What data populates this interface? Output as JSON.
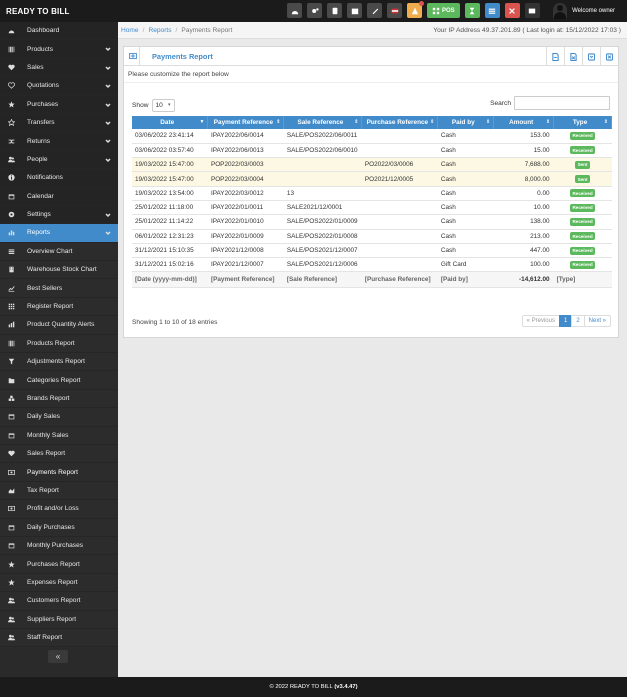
{
  "brand": "READY TO BILL",
  "topbar": {
    "pos_label": "POS",
    "welcome": "Welcome owner"
  },
  "sidebar": {
    "items": [
      {
        "label": "Dashboard",
        "icon": "dashboard-icon"
      },
      {
        "label": "Products",
        "icon": "barcode-icon",
        "chevron": true
      },
      {
        "label": "Sales",
        "icon": "heart-icon",
        "chevron": true
      },
      {
        "label": "Quotations",
        "icon": "heart-outline-icon",
        "chevron": true
      },
      {
        "label": "Purchases",
        "icon": "star-icon",
        "chevron": true
      },
      {
        "label": "Transfers",
        "icon": "star-outline-icon",
        "chevron": true
      },
      {
        "label": "Returns",
        "icon": "random-icon",
        "chevron": true
      },
      {
        "label": "People",
        "icon": "users-icon",
        "chevron": true
      },
      {
        "label": "Notifications",
        "icon": "info-icon"
      },
      {
        "label": "Calendar",
        "icon": "calendar-icon"
      },
      {
        "label": "Settings",
        "icon": "cog-icon",
        "chevron": true
      },
      {
        "label": "Reports",
        "icon": "chart-icon",
        "chevron": true
      }
    ],
    "report_items": [
      {
        "label": "Overview Chart",
        "icon": "bars-icon"
      },
      {
        "label": "Warehouse Stock Chart",
        "icon": "building-icon"
      },
      {
        "label": "Best Sellers",
        "icon": "line-chart-icon"
      },
      {
        "label": "Register Report",
        "icon": "th-icon"
      },
      {
        "label": "Product Quantity Alerts",
        "icon": "bar-chart-icon"
      },
      {
        "label": "Products Report",
        "icon": "barcode-icon"
      },
      {
        "label": "Adjustments Report",
        "icon": "filter-icon"
      },
      {
        "label": "Categories Report",
        "icon": "folder-icon"
      },
      {
        "label": "Brands Report",
        "icon": "cubes-icon"
      },
      {
        "label": "Daily Sales",
        "icon": "calendar-icon"
      },
      {
        "label": "Monthly Sales",
        "icon": "calendar-icon"
      },
      {
        "label": "Sales Report",
        "icon": "heart-icon"
      },
      {
        "label": "Payments Report",
        "icon": "money-icon"
      },
      {
        "label": "Tax Report",
        "icon": "area-chart-icon"
      },
      {
        "label": "Profit and/or Loss",
        "icon": "money-icon"
      },
      {
        "label": "Daily Purchases",
        "icon": "calendar-icon"
      },
      {
        "label": "Monthly Purchases",
        "icon": "calendar-icon"
      },
      {
        "label": "Purchases Report",
        "icon": "star-icon"
      },
      {
        "label": "Expenses Report",
        "icon": "star-icon"
      },
      {
        "label": "Customers Report",
        "icon": "users-icon"
      },
      {
        "label": "Suppliers Report",
        "icon": "users-icon"
      },
      {
        "label": "Staff Report",
        "icon": "users-icon"
      }
    ],
    "collapse_glyph": "«"
  },
  "breadcrumb": {
    "home": "Home",
    "reports": "Reports",
    "current": "Payments Report",
    "login_info": "Your IP Address 49.37.201.89 ( Last login at: 15/12/2022 17:03 )"
  },
  "box": {
    "title": "Payments Report",
    "intro": "Please customize the report below"
  },
  "controls": {
    "show_label": "Show",
    "page_size": "10",
    "search_label": "Search"
  },
  "table": {
    "headers": [
      "Date",
      "Payment Reference",
      "Sale Reference",
      "Purchase Reference",
      "Paid by",
      "Amount",
      "Type"
    ],
    "rows": [
      {
        "date": "03/06/2022 23:41:14",
        "payref": "IPAY2022/06/0014",
        "saleref": "SALE/POS2022/06/0011",
        "purref": "",
        "paidby": "Cash",
        "amount": "153.00",
        "type": "Received",
        "hl": false
      },
      {
        "date": "03/06/2022 03:57:40",
        "payref": "IPAY2022/06/0013",
        "saleref": "SALE/POS2022/06/0010",
        "purref": "",
        "paidby": "Cash",
        "amount": "15.00",
        "type": "Received",
        "hl": false
      },
      {
        "date": "19/03/2022 15:47:00",
        "payref": "POP2022/03/0003",
        "saleref": "",
        "purref": "PO2022/03/0006",
        "paidby": "Cash",
        "amount": "7,688.00",
        "type": "Sent",
        "hl": true
      },
      {
        "date": "19/03/2022 15:47:00",
        "payref": "POP2022/03/0004",
        "saleref": "",
        "purref": "PO2021/12/0005",
        "paidby": "Cash",
        "amount": "8,000.00",
        "type": "Sent",
        "hl": true
      },
      {
        "date": "19/03/2022 13:54:00",
        "payref": "IPAY2022/03/0012",
        "saleref": "13",
        "purref": "",
        "paidby": "Cash",
        "amount": "0.00",
        "type": "Received",
        "hl": false
      },
      {
        "date": "25/01/2022 11:18:00",
        "payref": "IPAY2022/01/0011",
        "saleref": "SALE2021/12/0001",
        "purref": "",
        "paidby": "Cash",
        "amount": "10.00",
        "type": "Received",
        "hl": false
      },
      {
        "date": "25/01/2022 11:14:22",
        "payref": "IPAY2022/01/0010",
        "saleref": "SALE/POS2022/01/0009",
        "purref": "",
        "paidby": "Cash",
        "amount": "138.00",
        "type": "Received",
        "hl": false
      },
      {
        "date": "06/01/2022 12:31:23",
        "payref": "IPAY2022/01/0009",
        "saleref": "SALE/POS2022/01/0008",
        "purref": "",
        "paidby": "Cash",
        "amount": "213.00",
        "type": "Received",
        "hl": false
      },
      {
        "date": "31/12/2021 15:10:35",
        "payref": "IPAY2021/12/0008",
        "saleref": "SALE/POS2021/12/0007",
        "purref": "",
        "paidby": "Cash",
        "amount": "447.00",
        "type": "Received",
        "hl": false
      },
      {
        "date": "31/12/2021 15:02:16",
        "payref": "IPAY2021/12/0007",
        "saleref": "SALE/POS2021/12/0006",
        "purref": "",
        "paidby": "Gift Card",
        "amount": "100.00",
        "type": "Received",
        "hl": false
      }
    ],
    "footer": [
      "[Date (yyyy-mm-dd)]",
      "[Payment Reference]",
      "[Sale Reference]",
      "[Purchase Reference]",
      "[Paid by]",
      "-14,612.00",
      "[Type]"
    ]
  },
  "pagination": {
    "info": "Showing 1 to 10 of 18 entries",
    "prev": "« Previous",
    "pages": [
      "1",
      "2"
    ],
    "next": "Next »"
  },
  "colors": {
    "primary": "#428bca",
    "received": "#5cb85c",
    "sent": "#5cb85c",
    "highlight_row": "#fcf8e3",
    "sidebar_bg": "#2a2a2a",
    "active_item": "#5ab8dc"
  },
  "footer": {
    "text": "© 2022 READY TO BILL",
    "version": "(v3.4.47)"
  }
}
